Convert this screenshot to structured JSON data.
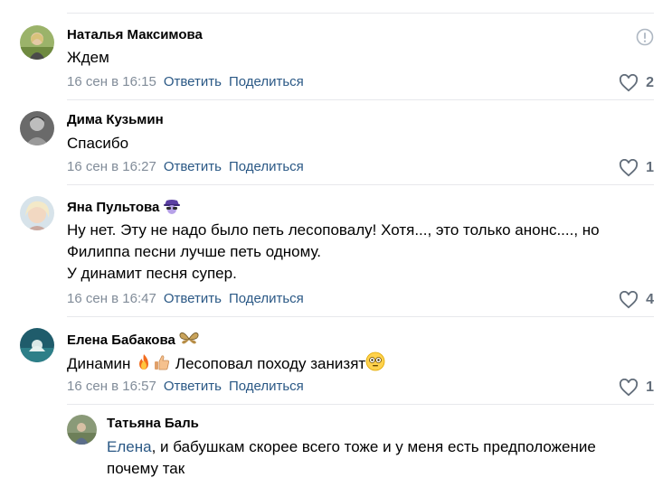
{
  "comments": [
    {
      "author": "Наталья Максимова",
      "text": "Ждем",
      "time": "16 сен в 16:15",
      "reply_label": "Ответить",
      "share_label": "Поделиться",
      "likes": "2",
      "avatar_icon": "avatar-photo"
    },
    {
      "author": "Дима Кузьмин",
      "text": "Спасибо",
      "time": "16 сен в 16:27",
      "reply_label": "Ответить",
      "share_label": "Поделиться",
      "likes": "1",
      "avatar_icon": "avatar-photo"
    },
    {
      "author": "Яна Пультова",
      "text_lines": [
        "Ну нет. Эту не надо было петь лесоповалу! Хотя..., это только анонс...., но",
        "Филиппа песни лучше петь одному.",
        "У динамит песня супер."
      ],
      "time": "16 сен в 16:47",
      "reply_label": "Ответить",
      "share_label": "Поделиться",
      "likes": "4",
      "badge_icon": "spy-emoji-icon"
    },
    {
      "author": "Елена Бабакова",
      "text_part1": "Динамин",
      "text_part2": "Лесоповал походу занизят",
      "time": "16 сен в 16:57",
      "reply_label": "Ответить",
      "share_label": "Поделиться",
      "likes": "1",
      "badge_icon": "butterfly-emoji-icon"
    },
    {
      "author": "Татьяна Баль",
      "mention": "Елена",
      "text_line1_rest": ", и бабушкам скорее всего тоже и у меня есть предположение",
      "text_line2": "почему так"
    }
  ],
  "colors": {
    "link": "#2a5885",
    "meta": "#818c99",
    "separator": "#e7e8ec",
    "like_icon": "#626d7a"
  }
}
